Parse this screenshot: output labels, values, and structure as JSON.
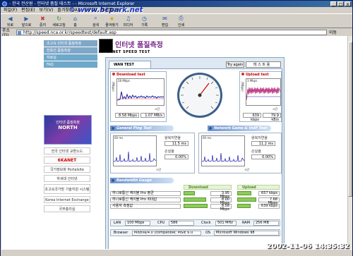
{
  "window": {
    "title": "- 한국 전산원 - 인터넷 품질 테스트 - - Microsoft Internet Explorer",
    "watermark": "© www.bcpark.net",
    "buttons": [
      "_",
      "□",
      "×"
    ]
  },
  "menu": [
    "파일(F)",
    "편집(E)",
    "보기(V)",
    "즐겨찾기(A)",
    "도구(T)",
    "도움말(H)"
  ],
  "toolbar": [
    {
      "label": "뒤로",
      "icon": "back-icon"
    },
    {
      "label": "앞으로",
      "icon": "forward-icon"
    },
    {
      "label": "중지",
      "icon": "stop-icon"
    },
    {
      "label": "새로고침",
      "icon": "refresh-icon"
    },
    {
      "label": "홈",
      "icon": "home-icon"
    },
    {
      "label": "검색",
      "icon": "search-icon"
    },
    {
      "label": "즐겨찾기",
      "icon": "favorites-icon"
    },
    {
      "label": "미디어",
      "icon": "media-icon"
    },
    {
      "label": "기록",
      "icon": "history-icon"
    },
    {
      "label": "편집",
      "icon": "mail-icon"
    },
    {
      "label": "인쇄",
      "icon": "print-icon"
    }
  ],
  "address": {
    "label": "주소(D)",
    "url": "http://speed.nca.or.kr/speedtest/default.asp",
    "go": "이동"
  },
  "sidebar": {
    "nav": [
      "초고속 인터넷 품질측정",
      "전용선 품질측정",
      "자료실",
      "FAQ"
    ],
    "banner_title": "인터넷 품질측정",
    "banner_sub": "NORTH",
    "links": [
      "한국 인터넷 교환노드",
      "6KANET",
      "국가정보화 Portalsite",
      "하세대 인터넷",
      "초고속국가망 기술지원 시스템",
      "Korea Internet Exchange",
      "국무총리실"
    ]
  },
  "logo": {
    "title": "인터넷 품질측정",
    "subtitle": "INTERNET SPEED TEST"
  },
  "panel": {
    "tab": "WAN TEST",
    "try_again": "Try again",
    "select": "테 스 트 용"
  },
  "download": {
    "title": "Download test",
    "scale": "28 Mbps",
    "time": "시간",
    "mbps": "8.58 Mbps",
    "mbs": "1.07 MB/s",
    "axis": "(Mbps)"
  },
  "upload": {
    "title": "Upload test",
    "scale": "3 Mbps",
    "time": "시간",
    "kbps": "639 kbps",
    "kbs": "79.9 kB/s",
    "axis": "(Mbps)"
  },
  "ping": {
    "title": "General Ping Test",
    "scale": "60 ms",
    "avg_label": "왕복지연율",
    "avg": "11.5 ms",
    "loss_label": "손실율",
    "loss": "0.00%",
    "time": "시간"
  },
  "voip": {
    "title": "Network Game & VoIP Test",
    "scale": "60 ms",
    "avg_label": "왕복지연율",
    "avg": "11.2 ms",
    "loss_label": "손실율",
    "loss": "0.00%",
    "time": "시간"
  },
  "bandwidth": {
    "title": "Bandwidth Gauge",
    "download_header": "Download",
    "upload_header": "Upload",
    "rows": [
      {
        "label": "하나로통신 케이블 Pro 평균",
        "down": "3.95 Mbps",
        "down_frac": 0.45,
        "up": "657 kbps",
        "up_frac": 0.7
      },
      {
        "label": "하나로통신 케이블 Pro 최대값",
        "down": "8.00 Mbps",
        "down_frac": 0.9,
        "up": "7.68 Mbps",
        "up_frac": 0.95
      },
      {
        "label": "사용자 측정값",
        "down": "8.58 Mbps",
        "down_frac": 0.95,
        "up": "639 kbps",
        "up_frac": 0.68
      }
    ]
  },
  "system": {
    "lan_label": "LAN",
    "lan": "100 Mbps",
    "cpu_label": "CPU",
    "cpu": "586",
    "clock_label": "Clock",
    "clock": "501 MHz",
    "ram_label": "RAM",
    "ram": "256 MB",
    "browser_label": "Browser",
    "browser": "Mozilla/4.0 (compatible; MSIE 6.0",
    "os_label": "OS",
    "os": "Microsoft Windows 98"
  },
  "timestamp": "2002-11-06 14:35:32"
}
